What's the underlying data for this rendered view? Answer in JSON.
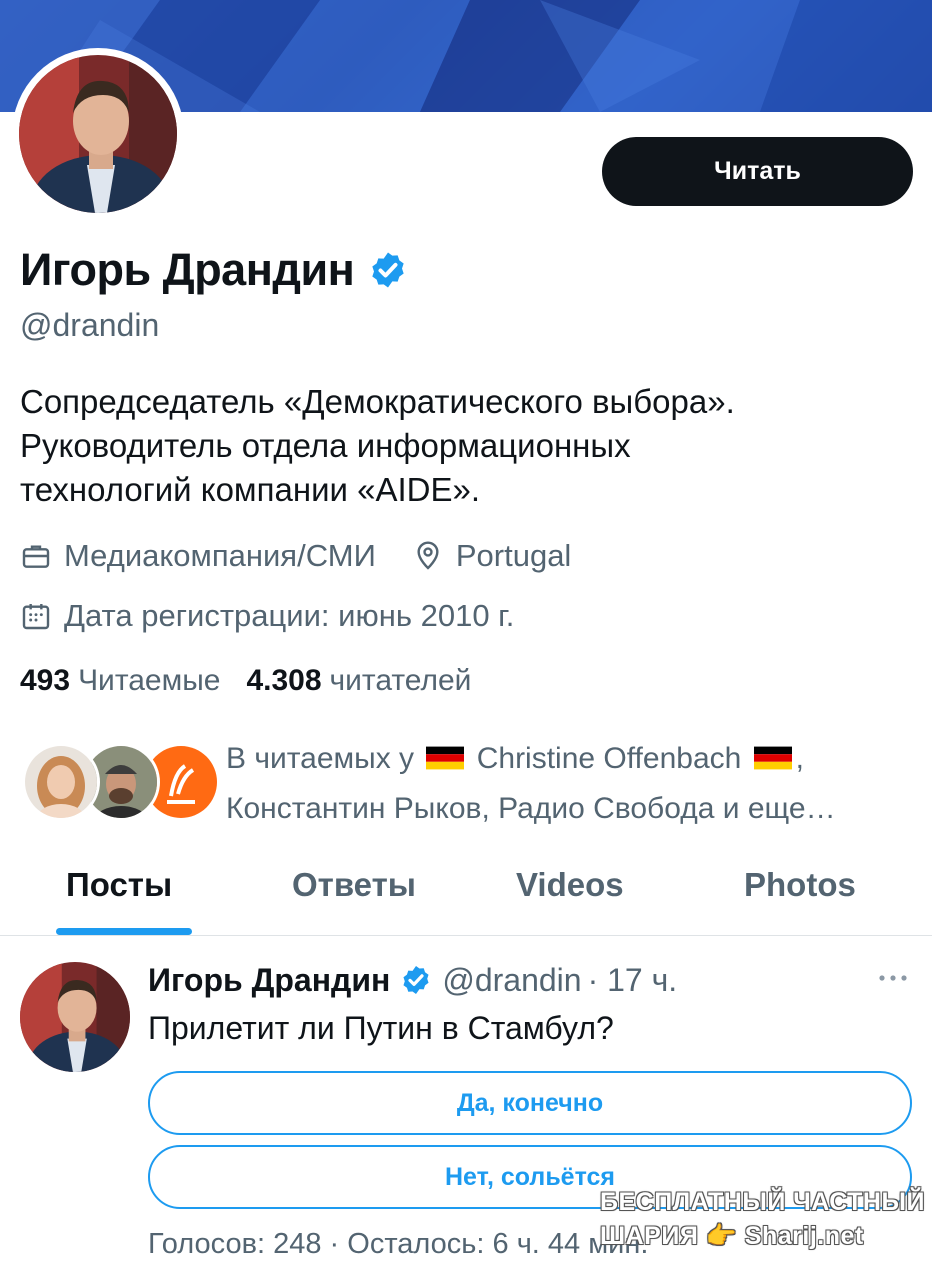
{
  "profile": {
    "follow_label": "Читать",
    "name": "Игорь Драндин",
    "handle": "@drandin",
    "bio": [
      "Сопредседатель «Демократического выбора».",
      "Руководитель отдела информационных",
      "технологий компании «AIDE»."
    ],
    "category": "Медиакомпания/СМИ",
    "location": "Portugal",
    "joined": "Дата регистрации: июнь 2010 г.",
    "following_count": "493",
    "following_label": "Читаемые",
    "followers_count": "4.308",
    "followers_label": "читателей",
    "followed_by_prefix": "В читаемых у",
    "followed_by_name1": "Christine Offenbach",
    "followed_by_comma": ",",
    "followed_by_line2": "Константин Рыков, Радио Свобода и еще…"
  },
  "tabs": [
    {
      "label": "Посты",
      "active": true
    },
    {
      "label": "Ответы",
      "active": false
    },
    {
      "label": "Videos",
      "active": false
    },
    {
      "label": "Photos",
      "active": false
    }
  ],
  "post": {
    "author_name": "Игорь Драндин",
    "author_handle": "@drandin",
    "time": "· 17 ч.",
    "text": "Прилетит ли Путин в Стамбул?",
    "poll_options": [
      "Да, конечно",
      "Нет, сольётся"
    ],
    "poll_footer": "Голосов: 248 · Осталось: 6 ч. 44 мин."
  },
  "watermark": {
    "line1": "БЕСПЛАТНЫЙ ЧАСТНЫЙ",
    "line2": "ШАРИЯ 👉 Sharij.net"
  },
  "colors": {
    "accent": "#1d9bf0",
    "text": "#0f1419",
    "muted": "#536471",
    "banner": "#2a56b8"
  },
  "icons": [
    "verified-badge-icon",
    "briefcase-icon",
    "location-pin-icon",
    "calendar-icon",
    "more-dots-icon",
    "germany-flag-icon"
  ]
}
